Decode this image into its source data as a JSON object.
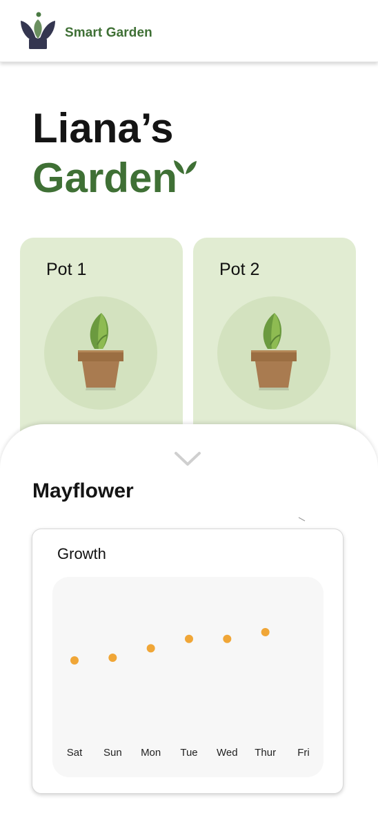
{
  "header": {
    "brand": "Smart Garden",
    "logo_icon": "lotus-pot-logo-icon"
  },
  "page": {
    "title_line1": "Liana’s",
    "title_line2": "Garden",
    "title_icon": "sprout-icon"
  },
  "pots": [
    {
      "label": "Pot 1",
      "icon": "potted-plant-icon"
    },
    {
      "label": "Pot 2",
      "icon": "potted-plant-icon"
    }
  ],
  "detail": {
    "toggle_icon": "chevron-down-icon",
    "plant_name": "Mayflower"
  },
  "growth": {
    "title": "Growth"
  },
  "colors": {
    "brand_green": "#3f7035",
    "card_green": "#e1ecd2",
    "point_orange": "#f0a637"
  },
  "chart_data": {
    "type": "scatter",
    "title": "Growth",
    "categories": [
      "Sat",
      "Sun",
      "Mon",
      "Tue",
      "Wed",
      "Thur",
      "Fri"
    ],
    "values": [
      38,
      40,
      47,
      54,
      54,
      59,
      null
    ],
    "ylim": [
      0,
      100
    ],
    "grid": false,
    "legend": "none"
  }
}
